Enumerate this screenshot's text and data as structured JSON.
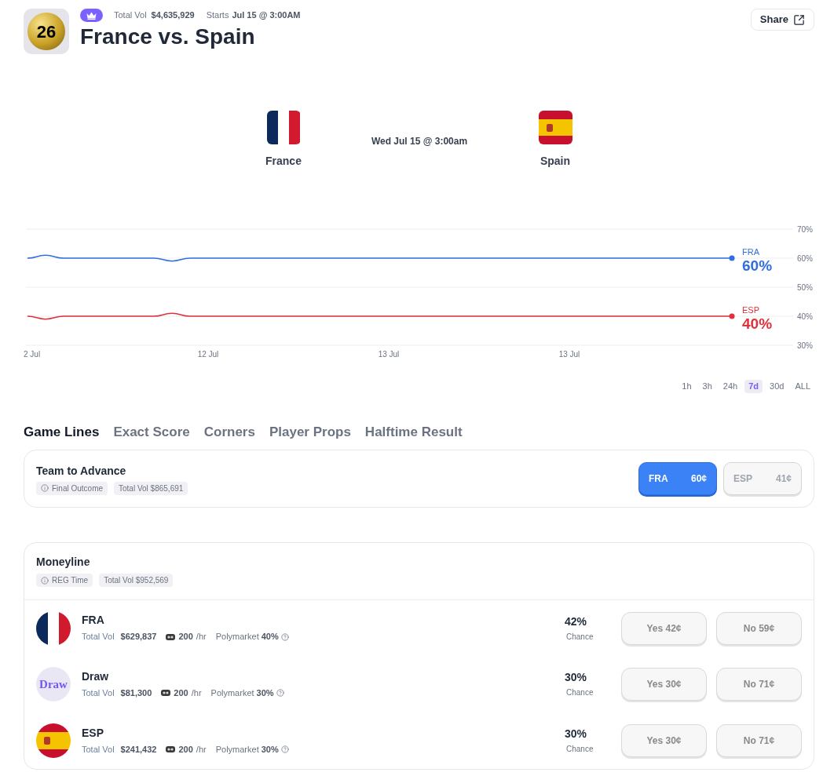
{
  "header": {
    "logo_text": "26",
    "total_vol_label": "Total Vol",
    "total_vol": "$4,635,929",
    "starts_label": "Starts",
    "starts": "Jul 15 @ 3:00AM",
    "title": "France vs. Spain",
    "share_button": "Share"
  },
  "matchup": {
    "teams": [
      {
        "kind": "france",
        "name": "France"
      },
      {
        "kind": "spain",
        "name": "Spain"
      }
    ],
    "kickoff": "Wed Jul 15 @ 3:00am"
  },
  "chart": {
    "chart_data": {
      "type": "line",
      "categories": [
        "2 Jul",
        null,
        null,
        null,
        null,
        null,
        null,
        null,
        null,
        null,
        "12 Jul",
        null,
        null,
        null,
        null,
        null,
        null,
        null,
        null,
        null,
        "13 Jul",
        null,
        null,
        null,
        null,
        null,
        null,
        null,
        null,
        null,
        "13 Jul",
        null,
        null,
        null,
        null,
        null,
        null,
        null,
        null,
        null
      ],
      "series": [
        {
          "name": "FRA",
          "color": "#2f6fdf",
          "values": [
            60,
            61,
            60,
            60,
            60,
            60,
            60,
            60,
            59,
            60,
            60,
            60,
            60,
            60,
            60,
            60,
            60,
            60,
            60,
            60,
            60,
            60,
            60,
            60,
            60,
            60,
            60,
            60,
            60,
            60,
            60,
            60,
            60,
            60,
            60,
            60,
            60,
            60,
            60,
            60
          ]
        },
        {
          "name": "ESP",
          "color": "#e0303c",
          "values": [
            40,
            39,
            40,
            40,
            40,
            40,
            40,
            40,
            41,
            40,
            40,
            40,
            40,
            40,
            40,
            40,
            40,
            40,
            40,
            40,
            40,
            40,
            40,
            40,
            40,
            40,
            40,
            40,
            40,
            40,
            40,
            40,
            40,
            40,
            40,
            40,
            40,
            40,
            40,
            40
          ]
        }
      ],
      "ylim": [
        30,
        70
      ],
      "yticks": [
        {
          "value": 70,
          "label": "70%"
        },
        {
          "value": 60,
          "label": "60%"
        },
        {
          "value": 50,
          "label": "50%"
        },
        {
          "value": 40,
          "label": "40%"
        },
        {
          "value": 30,
          "label": "30%"
        }
      ],
      "grid": true,
      "annotations": [
        "60%",
        "40%"
      ]
    }
  },
  "ranges": [
    {
      "label": "1h",
      "selected": false
    },
    {
      "label": "3h",
      "selected": false
    },
    {
      "label": "24h",
      "selected": false
    },
    {
      "label": "7d",
      "selected": true
    },
    {
      "label": "30d",
      "selected": false
    },
    {
      "label": "ALL",
      "selected": false
    }
  ],
  "tabs": [
    {
      "label": "Game Lines",
      "selected": true
    },
    {
      "label": "Exact Score",
      "selected": false
    },
    {
      "label": "Corners",
      "selected": false
    },
    {
      "label": "Player Props",
      "selected": false
    },
    {
      "label": "Halftime Result",
      "selected": false
    }
  ],
  "team_to_advance": {
    "title": "Team to Advance",
    "tags": [
      {
        "kind": "info",
        "label": "Final Outcome"
      },
      {
        "kind": "plain",
        "label": "Total Vol $865,691"
      }
    ],
    "options": [
      {
        "team": "FRA",
        "price": "60¢",
        "selected": true
      },
      {
        "team": "ESP",
        "price": "41¢",
        "selected": false
      }
    ]
  },
  "moneyline": {
    "title": "Moneyline",
    "tags": [
      {
        "kind": "info",
        "label": "REG Time"
      },
      {
        "kind": "plain",
        "label": "Total Vol $952,569"
      }
    ],
    "outcomes": [
      {
        "kind": "france",
        "name": "FRA",
        "vol_label": "Total Vol",
        "vol": "$629,837",
        "rate": "200",
        "rate_unit": "/hr",
        "source": "Polymarket",
        "source_pct": "40%",
        "chance": "42%",
        "chance_label": "Chance",
        "yes": "Yes 42¢",
        "no": "No 59¢"
      },
      {
        "kind": "text",
        "avatar_text": "Draw",
        "name": "Draw",
        "vol_label": "Total Vol",
        "vol": "$81,300",
        "rate": "200",
        "rate_unit": "/hr",
        "source": "Polymarket",
        "source_pct": "30%",
        "chance": "30%",
        "chance_label": "Chance",
        "yes": "Yes 30¢",
        "no": "No 71¢"
      },
      {
        "kind": "spain",
        "name": "ESP",
        "vol_label": "Total Vol",
        "vol": "$241,432",
        "rate": "200",
        "rate_unit": "/hr",
        "source": "Polymarket",
        "source_pct": "30%",
        "chance": "30%",
        "chance_label": "Chance",
        "yes": "Yes 30¢",
        "no": "No 71¢"
      }
    ]
  }
}
